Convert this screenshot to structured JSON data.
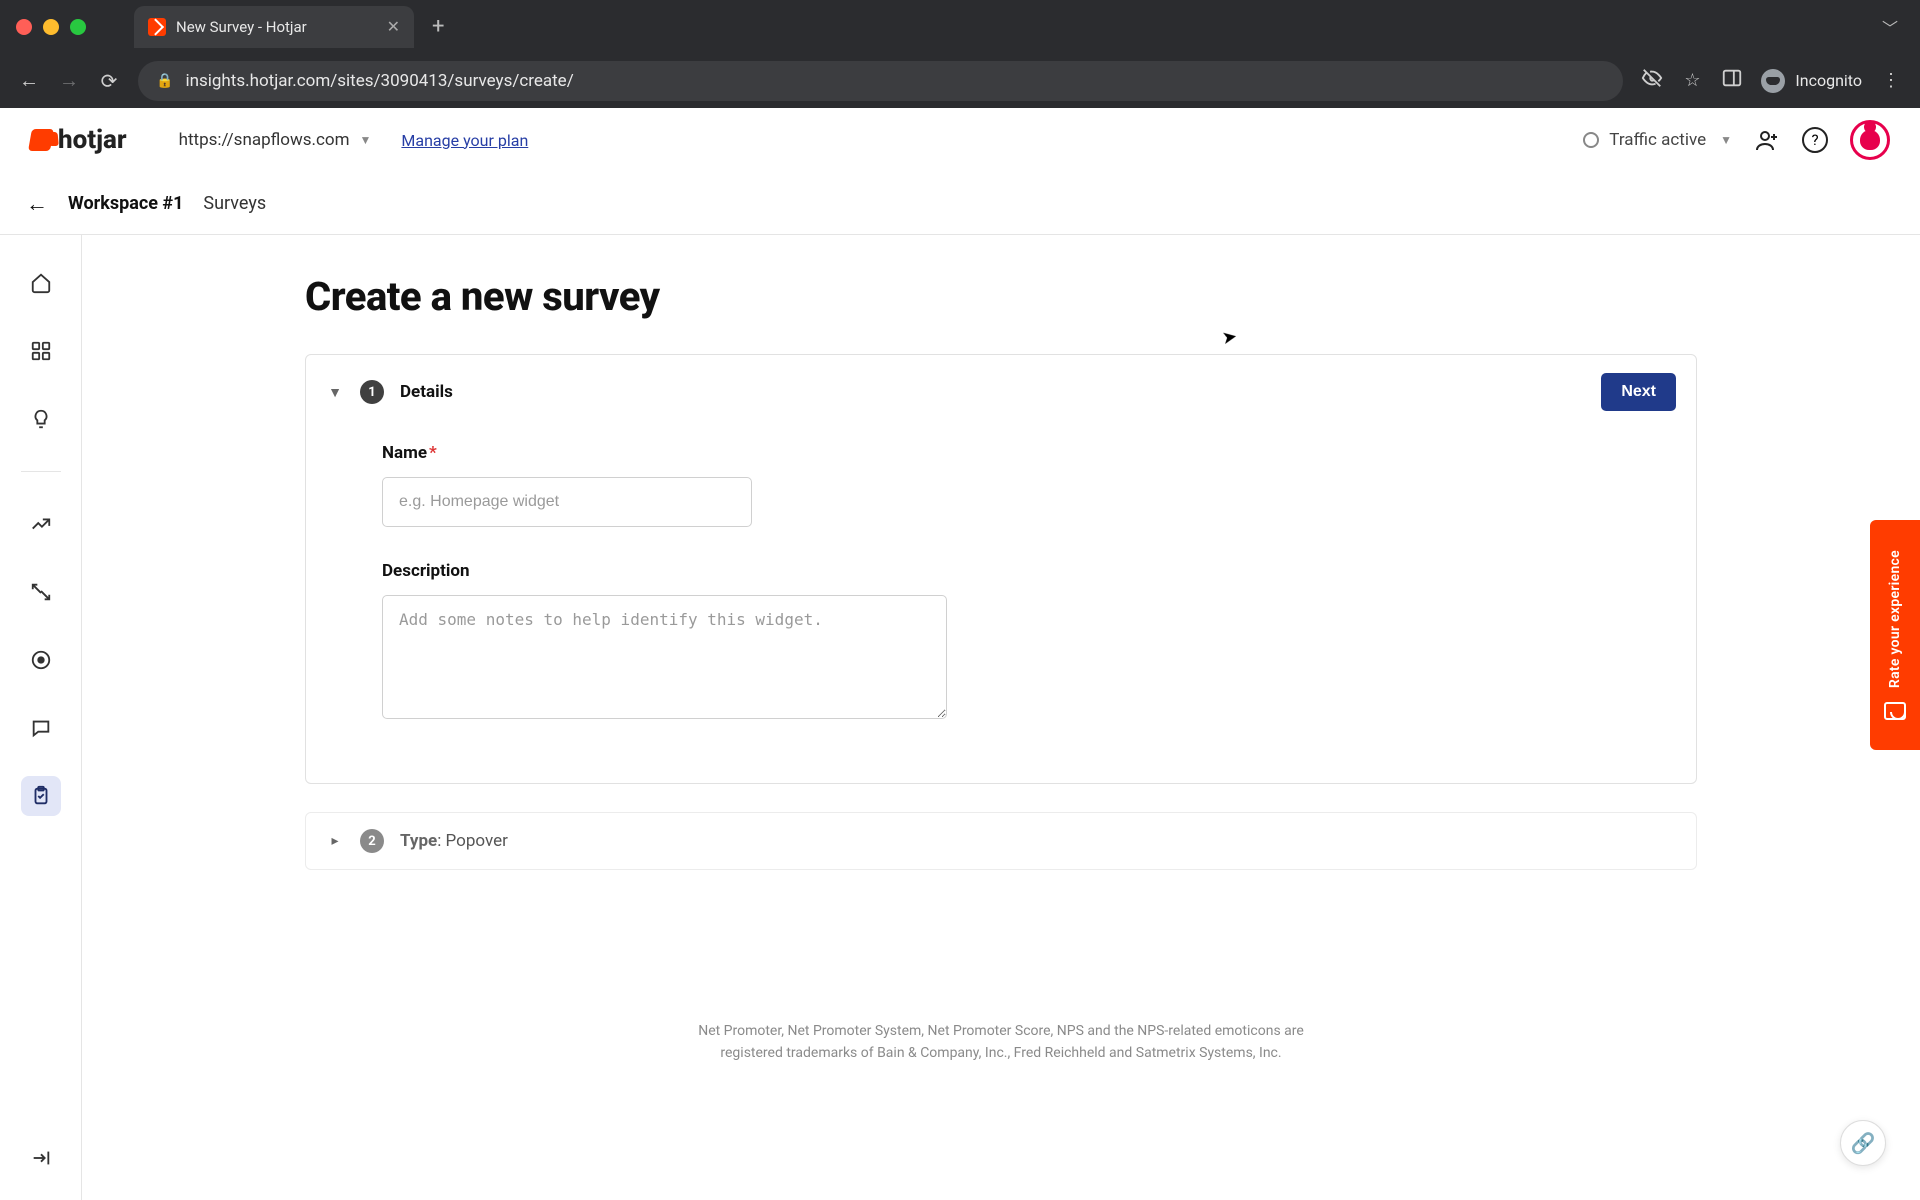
{
  "browser": {
    "tab_title": "New Survey - Hotjar",
    "url": "insights.hotjar.com/sites/3090413/surveys/create/",
    "incognito_label": "Incognito"
  },
  "header": {
    "logo_text": "hotjar",
    "site": "https://snapflows.com",
    "manage_plan": "Manage your plan",
    "traffic_status": "Traffic active"
  },
  "breadcrumb": {
    "workspace": "Workspace #1",
    "section": "Surveys"
  },
  "page": {
    "title": "Create a new survey"
  },
  "steps": {
    "details": {
      "number": "1",
      "title": "Details",
      "next_button": "Next",
      "name_label": "Name",
      "name_placeholder": "e.g. Homepage widget",
      "name_value": "",
      "description_label": "Description",
      "description_placeholder": "Add some notes to help identify this widget.",
      "description_value": ""
    },
    "type": {
      "number": "2",
      "title_prefix": "Type",
      "title_value": ": Popover"
    }
  },
  "footer": {
    "line1": "Net Promoter, Net Promoter System, Net Promoter Score, NPS and the NPS-related emoticons are",
    "line2": "registered trademarks of Bain & Company, Inc., Fred Reichheld and Satmetrix Systems, Inc."
  },
  "feedback_tab": "Rate your experience"
}
